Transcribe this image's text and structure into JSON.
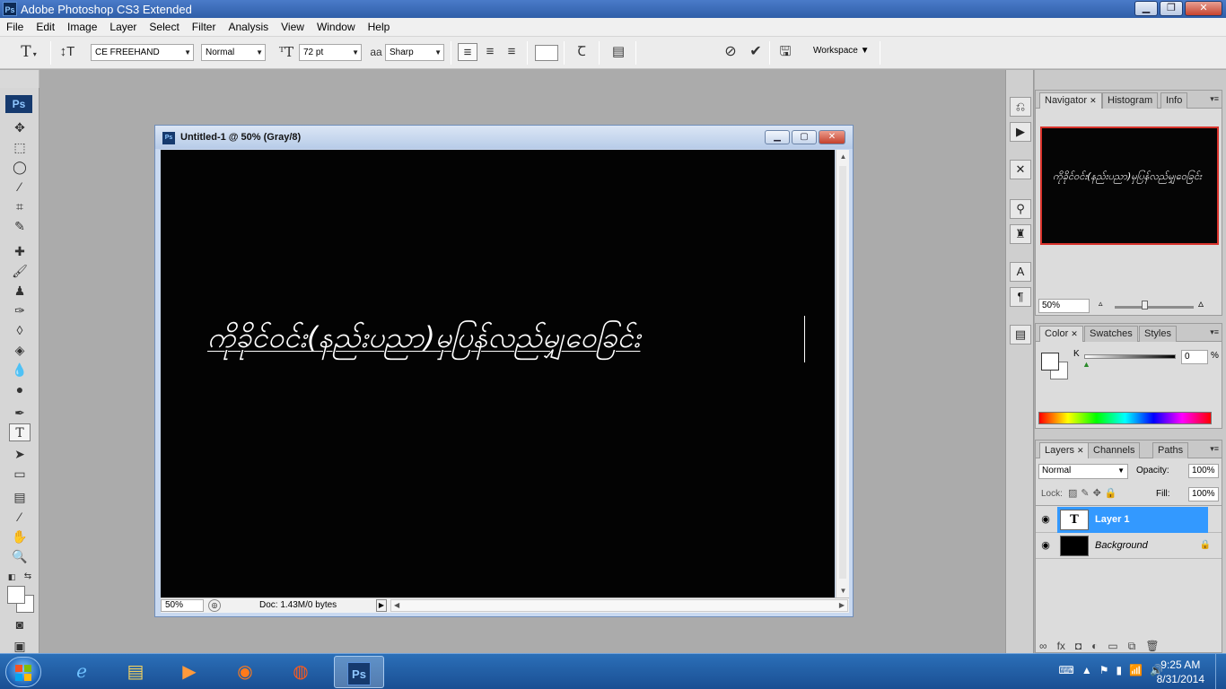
{
  "window": {
    "title": "Adobe Photoshop CS3 Extended",
    "app_badge": "Ps"
  },
  "menu": [
    "File",
    "Edit",
    "Image",
    "Layer",
    "Select",
    "Filter",
    "Analysis",
    "View",
    "Window",
    "Help"
  ],
  "options": {
    "font_family": "CE FREEHAND",
    "font_style": "Normal",
    "font_size": "72 pt",
    "aa_label": "a",
    "antialias": "Sharp",
    "workspace": "Workspace"
  },
  "tools_badge": "Ps",
  "document": {
    "title": "Untitled-1 @ 50% (Gray/8)",
    "icon_badge": "Ps",
    "canvas_text": "ကိုခိုင်ဝင်း(နည်းပညာ)မှပြန်လည်မျှဝေခြင်း",
    "zoom": "50%",
    "doc_info": "Doc: 1.43M/0 bytes"
  },
  "navigator": {
    "tabs": [
      "Navigator",
      "Histogram",
      "Info"
    ],
    "zoom": "50%",
    "thumb_text": "ကိုခိုင်ဝင်း(နည်းပညာ)မှပြန်လည်မျှဝေခြင်း",
    "view_box_color": "#d9332c"
  },
  "color_panel": {
    "tabs": [
      "Color",
      "Swatches",
      "Styles"
    ],
    "channel_label": "K",
    "value": "0",
    "unit": "%"
  },
  "layers_panel": {
    "tabs": [
      "Layers",
      "Channels",
      "Paths"
    ],
    "blend_mode": "Normal",
    "opacity_label": "Opacity:",
    "opacity": "100%",
    "lock_label": "Lock:",
    "fill_label": "Fill:",
    "fill": "100%",
    "layers": [
      {
        "name": "Layer 1",
        "thumb_glyph": "T",
        "selected": true
      },
      {
        "name": "Background",
        "selected": false,
        "locked": true
      }
    ]
  },
  "taskbar": {
    "time": "9:25 AM",
    "date": "8/31/2014",
    "ps_badge": "Ps"
  },
  "colors": {
    "accent": "#3399ff",
    "canvas": "#030303",
    "workspace": "#ababab"
  }
}
